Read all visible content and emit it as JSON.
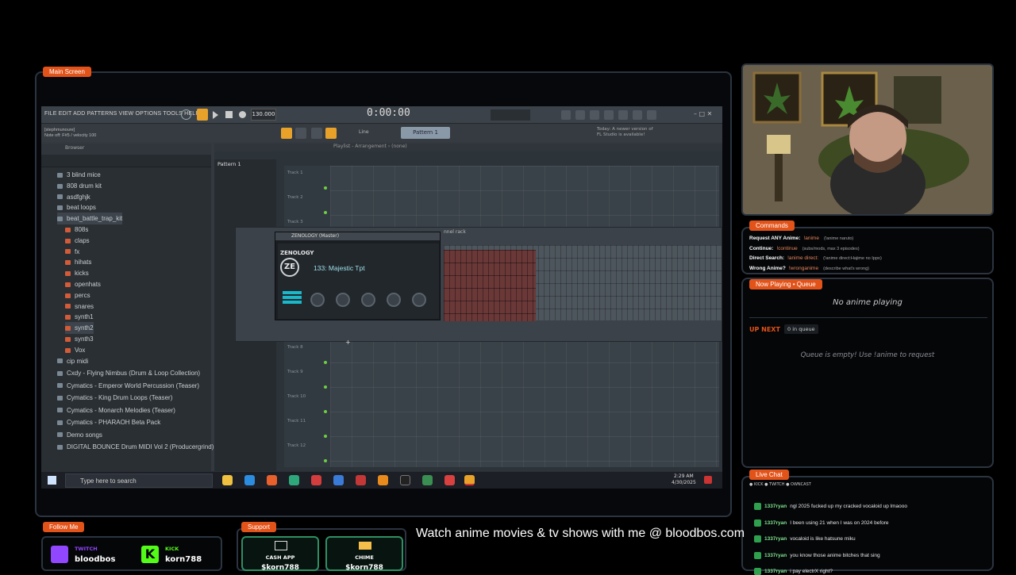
{
  "main_screen": {
    "label": "Main Screen"
  },
  "fl_studio": {
    "menu": "FILE  EDIT  ADD  PATTERNS  VIEW  OPTIONS  TOOLS  HELP",
    "tempo": "130.000",
    "time": "0:00:00",
    "hint_line1": "[stephmunoure]",
    "hint_line2": "Note off: F#5 / velocity 100",
    "pattern_button": "Pattern 1",
    "update_notice_line1": "Today: A newer version of",
    "update_notice_line2": "FL Studio is available!",
    "line_label": "Line",
    "browser_title": "Browser",
    "playlist_title": "Playlist - Arrangement › (none)",
    "pattern_item": "Pattern 1",
    "channel_rack_title": "nnel rack",
    "browser_items": [
      "3 blind mice",
      "808 drum kit",
      "asdfghjk",
      "beat loops",
      "beat_battle_trap_kit",
      "808s",
      "claps",
      "fx",
      "hihats",
      "kicks",
      "openhats",
      "percs",
      "snares",
      "synth1",
      "synth2",
      "synth3",
      "Vox",
      "cip midi",
      "Cxdy - Flying Nimbus (Drum & Loop Collection)",
      "Cymatics - Emperor World Percussion (Teaser)",
      "Cymatics - King Drum Loops (Teaser)",
      "Cymatics - Monarch Melodies (Teaser)",
      "Cymatics - PHARAOH Beta Pack",
      "Demo songs",
      "DIGITAL BOUNCE Drum MIDI Vol 2 (Producergrind)"
    ],
    "tracks": [
      "Track 1",
      "Track 2",
      "Track 3",
      "Track 8",
      "Track 9",
      "Track 10",
      "Track 11",
      "Track 12"
    ],
    "zenology": {
      "title": "ZENOLOGY (Master)",
      "brand": "ZENOLOGY",
      "logo": "ZE",
      "patch": "133: Majestic Tpt",
      "knobs": [
        "CUTOFF",
        "RESO",
        "ATTACK",
        "RELEASE",
        "PORMTO"
      ]
    }
  },
  "taskbar": {
    "search_placeholder": "Type here to search",
    "time": "2:29 AM",
    "date": "4/30/2025"
  },
  "commands": {
    "label": "Commands",
    "rows": [
      {
        "title": "Request ANY Anime:",
        "cmd": "!anime",
        "desc": "(!anime naruto)"
      },
      {
        "title": "Continue:",
        "cmd": "!continue",
        "desc": "(subs/mods, max 3 episodes)"
      },
      {
        "title": "Direct Search:",
        "cmd": "!anime direct:",
        "desc": "(!anime direct:Hajime no Ippo)"
      },
      {
        "title": "Wrong Anime?",
        "cmd": "!wronganime",
        "desc": "(describe what's wrong)"
      }
    ]
  },
  "now_playing": {
    "label": "Now Playing • Queue",
    "status": "No anime playing",
    "up_next": "UP NEXT",
    "queue_count": "0 in queue",
    "empty_msg": "Queue is empty! Use !anime to request"
  },
  "live_chat": {
    "label": "Live Chat",
    "platforms": "● KICK  ● TWITCH  ● OWNCAST",
    "messages": [
      {
        "user": "1337ryan",
        "text": "ngl 2025 fucked up my cracked vocaloid up lmaooo"
      },
      {
        "user": "1337ryan",
        "text": "I been using 21 when I was on 2024 before"
      },
      {
        "user": "1337ryan",
        "text": "vocaloid is like hatsune miku"
      },
      {
        "user": "1337ryan",
        "text": "you know those anime bitches that sing"
      },
      {
        "user": "1337ryan",
        "text": "i pay electrX right?"
      }
    ]
  },
  "follow": {
    "label": "Follow Me",
    "accounts": [
      {
        "platform": "TWITCH",
        "handle": "bloodbos",
        "color": "#9146ff"
      },
      {
        "platform": "KICK",
        "handle": "korn788",
        "color": "#53fc18"
      }
    ]
  },
  "support": {
    "label": "Support",
    "options": [
      {
        "name": "CASH APP",
        "handle": "$korn788"
      },
      {
        "name": "CHIME",
        "handle": "$korn788"
      }
    ]
  },
  "ticker": {
    "text": "Watch anime movies & tv shows with me @ bloodbos.com"
  },
  "colors": {
    "accent": "#e2531a",
    "panel_border": "#2b3440",
    "chat_green": "#2fa14e"
  }
}
